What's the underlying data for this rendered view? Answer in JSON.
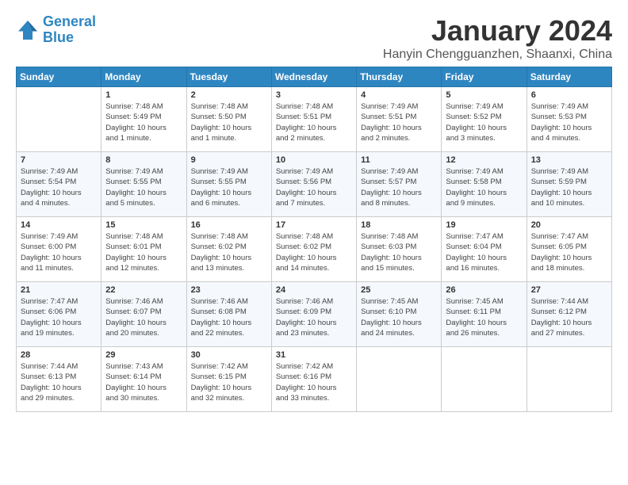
{
  "logo": {
    "line1": "General",
    "line2": "Blue"
  },
  "title": "January 2024",
  "subtitle": "Hanyin Chengguanzhen, Shaanxi, China",
  "days_header": [
    "Sunday",
    "Monday",
    "Tuesday",
    "Wednesday",
    "Thursday",
    "Friday",
    "Saturday"
  ],
  "weeks": [
    [
      {
        "num": "",
        "info": ""
      },
      {
        "num": "1",
        "info": "Sunrise: 7:48 AM\nSunset: 5:49 PM\nDaylight: 10 hours\nand 1 minute."
      },
      {
        "num": "2",
        "info": "Sunrise: 7:48 AM\nSunset: 5:50 PM\nDaylight: 10 hours\nand 1 minute."
      },
      {
        "num": "3",
        "info": "Sunrise: 7:48 AM\nSunset: 5:51 PM\nDaylight: 10 hours\nand 2 minutes."
      },
      {
        "num": "4",
        "info": "Sunrise: 7:49 AM\nSunset: 5:51 PM\nDaylight: 10 hours\nand 2 minutes."
      },
      {
        "num": "5",
        "info": "Sunrise: 7:49 AM\nSunset: 5:52 PM\nDaylight: 10 hours\nand 3 minutes."
      },
      {
        "num": "6",
        "info": "Sunrise: 7:49 AM\nSunset: 5:53 PM\nDaylight: 10 hours\nand 4 minutes."
      }
    ],
    [
      {
        "num": "7",
        "info": "Sunrise: 7:49 AM\nSunset: 5:54 PM\nDaylight: 10 hours\nand 4 minutes."
      },
      {
        "num": "8",
        "info": "Sunrise: 7:49 AM\nSunset: 5:55 PM\nDaylight: 10 hours\nand 5 minutes."
      },
      {
        "num": "9",
        "info": "Sunrise: 7:49 AM\nSunset: 5:55 PM\nDaylight: 10 hours\nand 6 minutes."
      },
      {
        "num": "10",
        "info": "Sunrise: 7:49 AM\nSunset: 5:56 PM\nDaylight: 10 hours\nand 7 minutes."
      },
      {
        "num": "11",
        "info": "Sunrise: 7:49 AM\nSunset: 5:57 PM\nDaylight: 10 hours\nand 8 minutes."
      },
      {
        "num": "12",
        "info": "Sunrise: 7:49 AM\nSunset: 5:58 PM\nDaylight: 10 hours\nand 9 minutes."
      },
      {
        "num": "13",
        "info": "Sunrise: 7:49 AM\nSunset: 5:59 PM\nDaylight: 10 hours\nand 10 minutes."
      }
    ],
    [
      {
        "num": "14",
        "info": "Sunrise: 7:49 AM\nSunset: 6:00 PM\nDaylight: 10 hours\nand 11 minutes."
      },
      {
        "num": "15",
        "info": "Sunrise: 7:48 AM\nSunset: 6:01 PM\nDaylight: 10 hours\nand 12 minutes."
      },
      {
        "num": "16",
        "info": "Sunrise: 7:48 AM\nSunset: 6:02 PM\nDaylight: 10 hours\nand 13 minutes."
      },
      {
        "num": "17",
        "info": "Sunrise: 7:48 AM\nSunset: 6:02 PM\nDaylight: 10 hours\nand 14 minutes."
      },
      {
        "num": "18",
        "info": "Sunrise: 7:48 AM\nSunset: 6:03 PM\nDaylight: 10 hours\nand 15 minutes."
      },
      {
        "num": "19",
        "info": "Sunrise: 7:47 AM\nSunset: 6:04 PM\nDaylight: 10 hours\nand 16 minutes."
      },
      {
        "num": "20",
        "info": "Sunrise: 7:47 AM\nSunset: 6:05 PM\nDaylight: 10 hours\nand 18 minutes."
      }
    ],
    [
      {
        "num": "21",
        "info": "Sunrise: 7:47 AM\nSunset: 6:06 PM\nDaylight: 10 hours\nand 19 minutes."
      },
      {
        "num": "22",
        "info": "Sunrise: 7:46 AM\nSunset: 6:07 PM\nDaylight: 10 hours\nand 20 minutes."
      },
      {
        "num": "23",
        "info": "Sunrise: 7:46 AM\nSunset: 6:08 PM\nDaylight: 10 hours\nand 22 minutes."
      },
      {
        "num": "24",
        "info": "Sunrise: 7:46 AM\nSunset: 6:09 PM\nDaylight: 10 hours\nand 23 minutes."
      },
      {
        "num": "25",
        "info": "Sunrise: 7:45 AM\nSunset: 6:10 PM\nDaylight: 10 hours\nand 24 minutes."
      },
      {
        "num": "26",
        "info": "Sunrise: 7:45 AM\nSunset: 6:11 PM\nDaylight: 10 hours\nand 26 minutes."
      },
      {
        "num": "27",
        "info": "Sunrise: 7:44 AM\nSunset: 6:12 PM\nDaylight: 10 hours\nand 27 minutes."
      }
    ],
    [
      {
        "num": "28",
        "info": "Sunrise: 7:44 AM\nSunset: 6:13 PM\nDaylight: 10 hours\nand 29 minutes."
      },
      {
        "num": "29",
        "info": "Sunrise: 7:43 AM\nSunset: 6:14 PM\nDaylight: 10 hours\nand 30 minutes."
      },
      {
        "num": "30",
        "info": "Sunrise: 7:42 AM\nSunset: 6:15 PM\nDaylight: 10 hours\nand 32 minutes."
      },
      {
        "num": "31",
        "info": "Sunrise: 7:42 AM\nSunset: 6:16 PM\nDaylight: 10 hours\nand 33 minutes."
      },
      {
        "num": "",
        "info": ""
      },
      {
        "num": "",
        "info": ""
      },
      {
        "num": "",
        "info": ""
      }
    ]
  ]
}
